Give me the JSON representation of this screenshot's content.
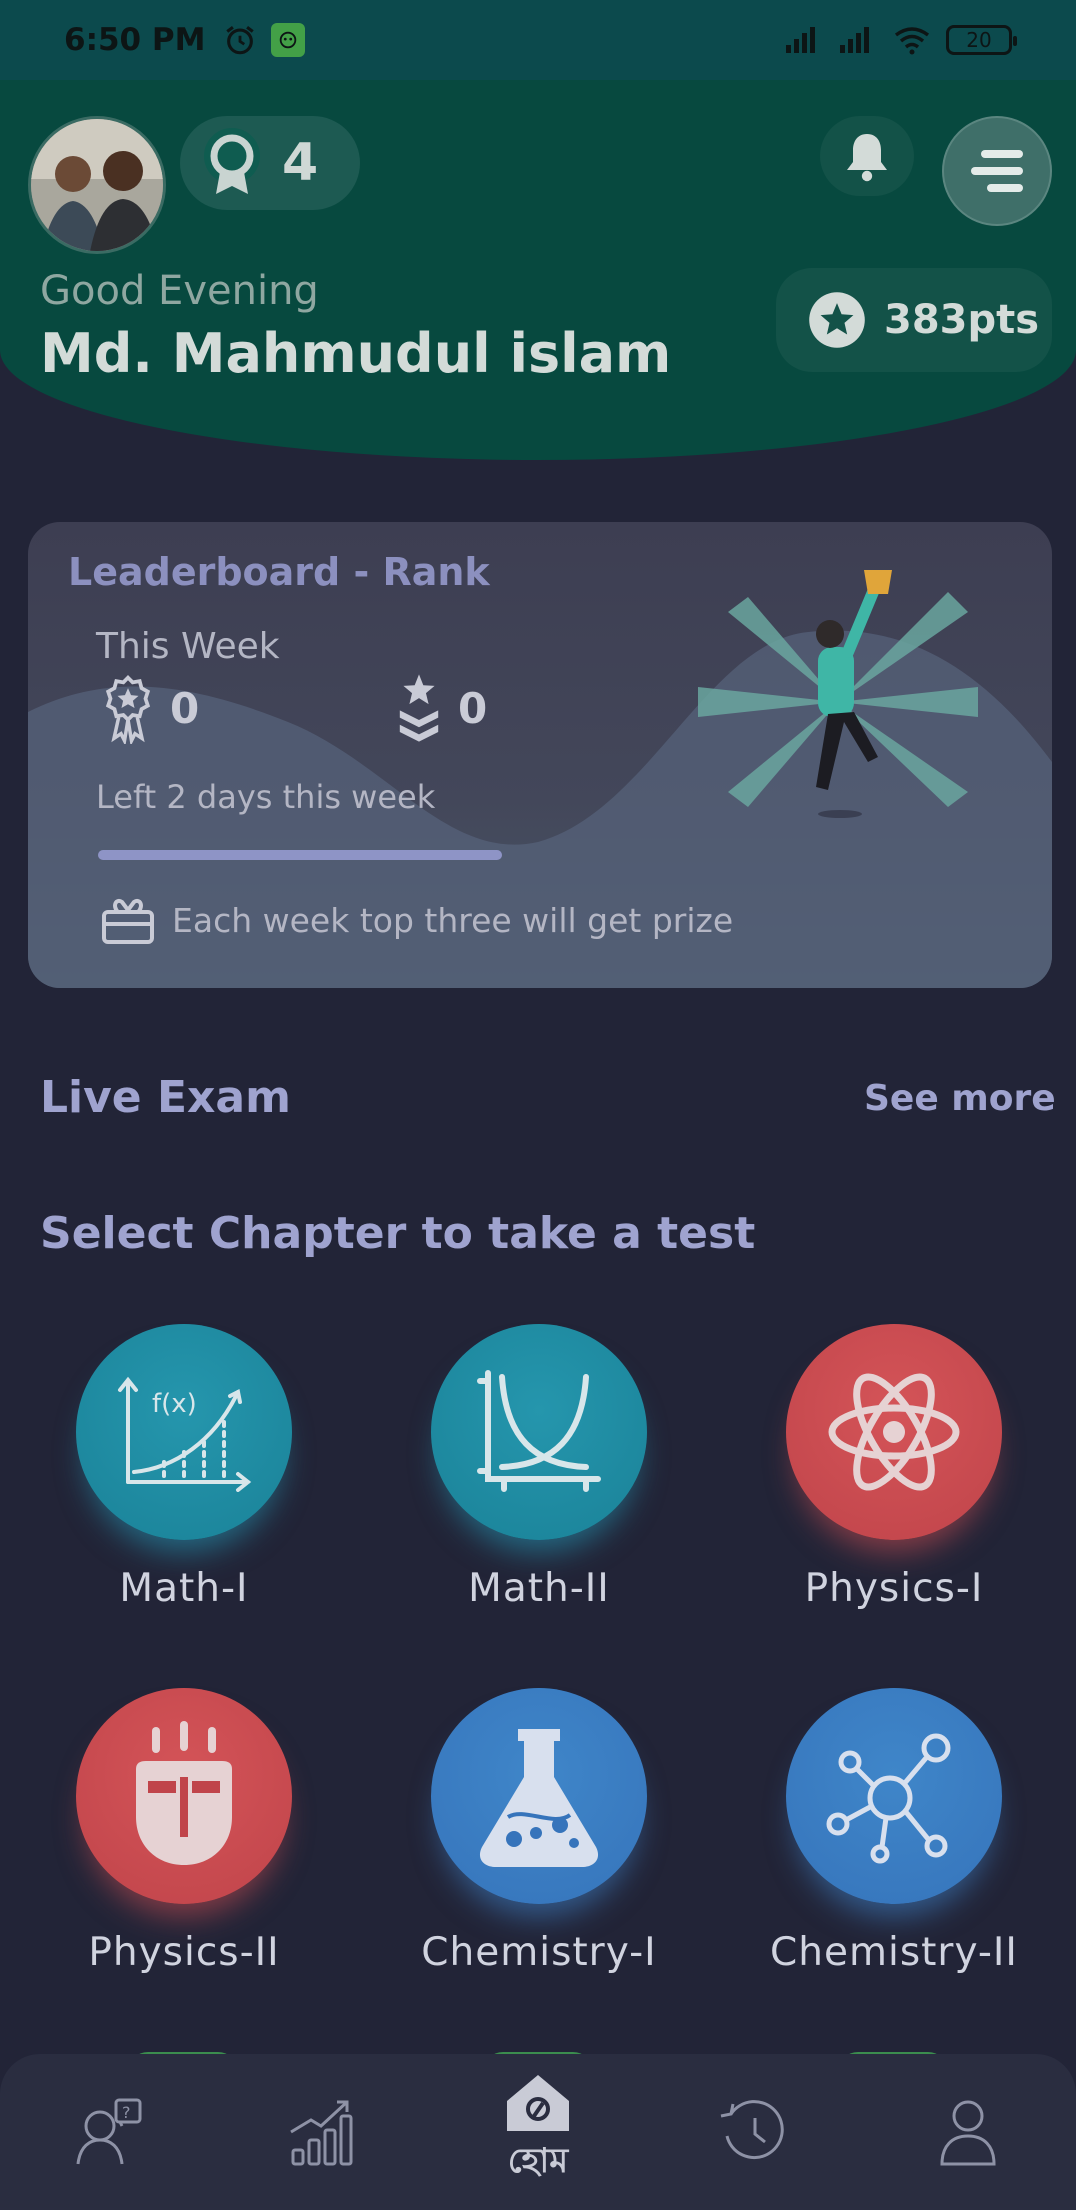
{
  "status_bar": {
    "time": "6:50 PM",
    "battery": "20"
  },
  "header": {
    "badge_count": "4",
    "greeting": "Good Evening",
    "username": "Md. Mahmudul islam",
    "points": "383pts"
  },
  "leaderboard": {
    "title": "Leaderboard - Rank",
    "period": "This Week",
    "rank_value": "0",
    "star_value": "0",
    "days_left": "Left 2 days this week",
    "progress_fraction": 1.0,
    "prize_text": "Each week top three will get prize"
  },
  "live_exam": {
    "title": "Live Exam",
    "see_more": "See more"
  },
  "chapters": {
    "title": "Select Chapter to take a test",
    "items": [
      {
        "label": "Math-I",
        "icon": "function-graph-icon",
        "color": "#2596ad"
      },
      {
        "label": "Math-II",
        "icon": "curve-graph-icon",
        "color": "#2596ad"
      },
      {
        "label": "Physics-I",
        "icon": "atom-icon",
        "color": "#d45458"
      },
      {
        "label": "Physics-II",
        "icon": "magnet-icon",
        "color": "#d45458"
      },
      {
        "label": "Chemistry-I",
        "icon": "flask-icon",
        "color": "#3f86c9"
      },
      {
        "label": "Chemistry-II",
        "icon": "molecule-icon",
        "color": "#3f86c9"
      }
    ]
  },
  "bottom_nav": {
    "items": [
      {
        "icon": "question-person-icon"
      },
      {
        "icon": "growth-chart-icon"
      },
      {
        "icon": "home-icon",
        "label": "হোম"
      },
      {
        "icon": "history-icon"
      },
      {
        "icon": "profile-icon"
      }
    ]
  }
}
